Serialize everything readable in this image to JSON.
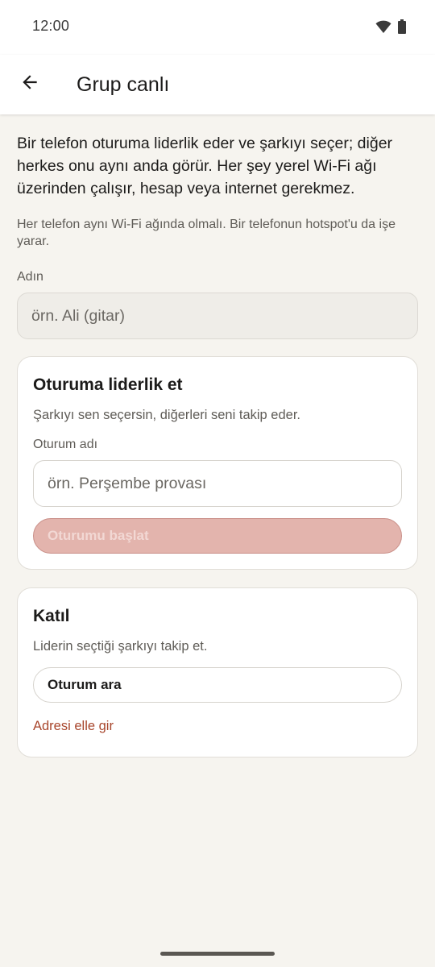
{
  "status_bar": {
    "time": "12:00",
    "icons": [
      "wifi-icon",
      "battery-icon"
    ]
  },
  "app_bar": {
    "back_icon": "arrow-left-icon",
    "title": "Grup canlı"
  },
  "intro": {
    "description": "Bir telefon oturuma liderlik eder ve şarkıyı seçer; diğer herkes onu aynı anda görür. Her şey yerel Wi-Fi ağı üzerinden çalışır, hesap veya internet gerekmez.",
    "note": "Her telefon aynı Wi-Fi ağında olmalı. Bir telefonun hotspot'u da işe yarar."
  },
  "name_field": {
    "label": "Adın",
    "placeholder": "örn. Ali (gitar)",
    "value": ""
  },
  "lead_card": {
    "title": "Oturuma liderlik et",
    "subtitle": "Şarkıyı sen seçersin, diğerleri seni takip eder.",
    "session_label": "Oturum adı",
    "session_placeholder": "örn. Perşembe provası",
    "session_value": "",
    "start_button": "Oturumu başlat",
    "start_enabled": false
  },
  "join_card": {
    "title": "Katıl",
    "subtitle": "Liderin seçtiği şarkıyı takip et.",
    "search_button": "Oturum ara",
    "manual_link": "Adresi elle gir"
  },
  "colors": {
    "background": "#f6f4ef",
    "surface": "#ffffff",
    "accent": "#a8462c",
    "disabled_button": "#e3b4ad"
  }
}
